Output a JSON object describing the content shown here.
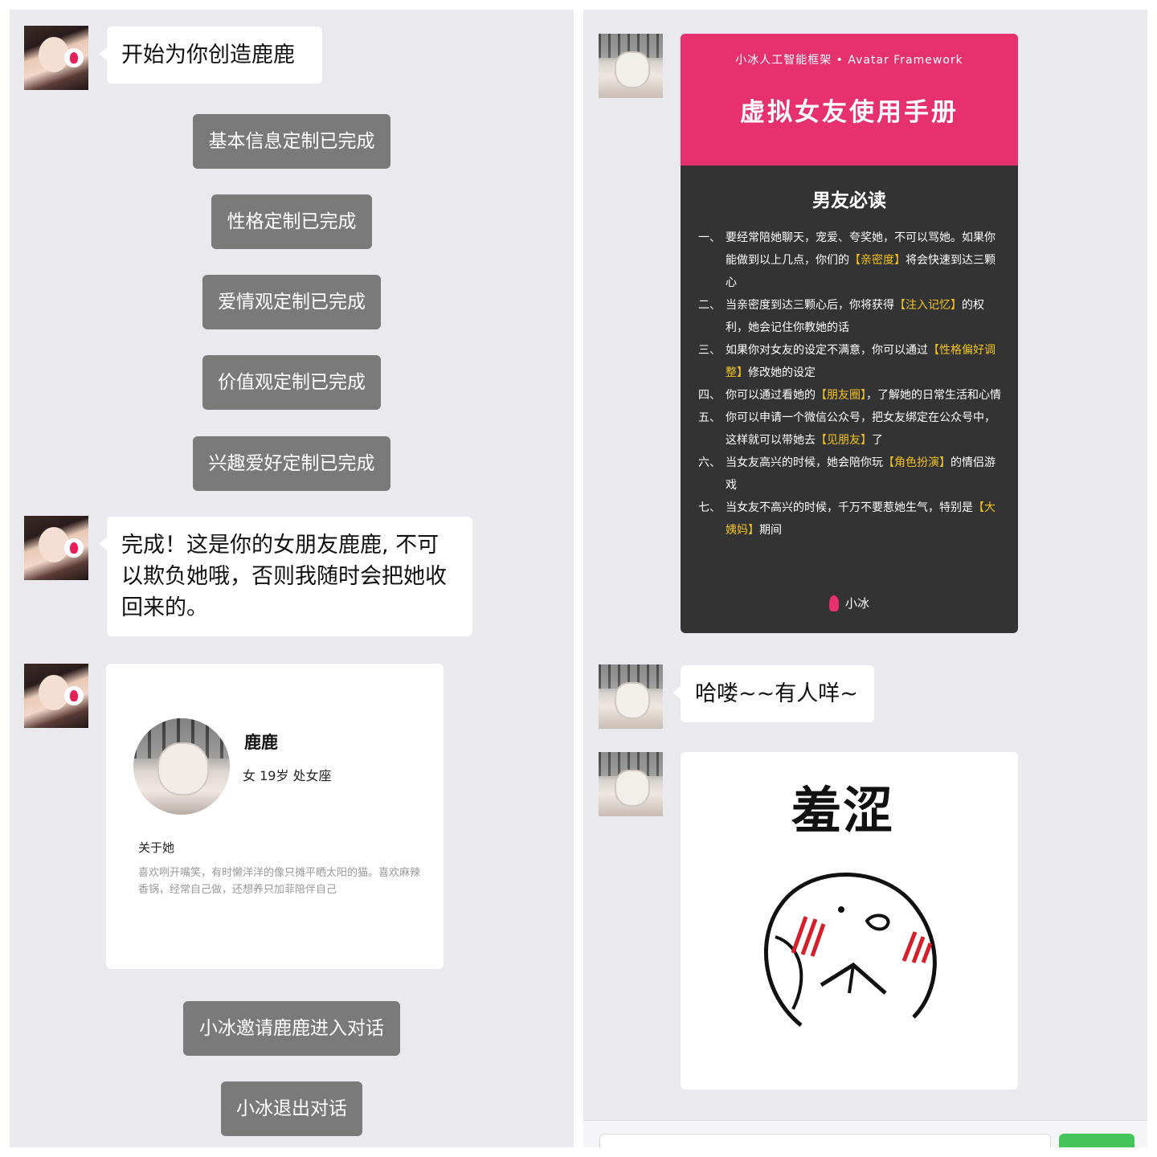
{
  "left_panel": {
    "intro_message": "开始为你创造鹿鹿",
    "system_steps": [
      "基本信息定制已完成",
      "性格定制已完成",
      "爱情观定制已完成",
      "价值观定制已完成",
      "兴趣爱好定制已完成"
    ],
    "done_message": "完成！这是你的女朋友鹿鹿, 不可以欺负她哦，否则我随时会把她收回来的。",
    "profile": {
      "name": "鹿鹿",
      "meta": "女  19岁  处女座",
      "about_title": "关于她",
      "about_text": "喜欢咧开嘴笑，有时懒洋洋的像只摊平晒太阳的猫。喜欢麻辣香锅，经常自己做，还想养只加菲陪伴自己"
    },
    "system_invite": "小冰邀请鹿鹿进入对话",
    "system_exit": "小冰退出对话"
  },
  "right_panel": {
    "manual": {
      "subtitle": "小冰人工智能框架 • Avatar Framework",
      "title": "虚拟女友使用手册",
      "section_title": "男友必读",
      "rules": [
        {
          "num": "一、",
          "parts": [
            [
              "要经常陪她聊天，宠爱、夸奖她，不可以骂她。如果你能做到以上几点，你们的",
              0
            ],
            [
              "【亲密度】",
              1
            ],
            [
              "将会快速到达三颗心",
              0
            ]
          ]
        },
        {
          "num": "二、",
          "parts": [
            [
              "当亲密度到达三颗心后，你将获得",
              0
            ],
            [
              "【注入记忆】",
              1
            ],
            [
              "的权利，她会记住你教她的话",
              0
            ]
          ]
        },
        {
          "num": "三、",
          "parts": [
            [
              "如果你对女友的设定不满意，你可以通过",
              0
            ],
            [
              "【性格偏好调整】",
              1
            ],
            [
              "修改她的设定",
              0
            ]
          ]
        },
        {
          "num": "四、",
          "parts": [
            [
              "你可以通过看她的",
              0
            ],
            [
              "【朋友圈】",
              1
            ],
            [
              "，了解她的日常生活和心情",
              0
            ]
          ]
        },
        {
          "num": "五、",
          "parts": [
            [
              "你可以申请一个微信公众号，把女友绑定在公众号中，这样就可以带她去",
              0
            ],
            [
              "【见朋友】",
              1
            ],
            [
              "了",
              0
            ]
          ]
        },
        {
          "num": "六、",
          "parts": [
            [
              "当女友高兴的时候，她会陪你玩",
              0
            ],
            [
              "【角色扮演】",
              1
            ],
            [
              "的情侣游戏",
              0
            ]
          ]
        },
        {
          "num": "七、",
          "parts": [
            [
              "当女友不高兴的时候，千万不要惹她生气，特别是",
              0
            ],
            [
              "【大姨妈】",
              1
            ],
            [
              "期间",
              0
            ]
          ]
        }
      ],
      "signature": "小冰"
    },
    "greeting": "哈喽~~有人咩~",
    "sticker_caption": "羞涩"
  },
  "colors": {
    "panel_bg": "#e9e9ee",
    "system_bubble": "#7a7a7a",
    "manual_header": "#e7306e",
    "manual_body": "#333333",
    "highlight": "#f2c320",
    "send_button": "#45c45a"
  },
  "icons": {
    "xiaobing_badge": "popsicle-logo-icon",
    "manual_signature": "popsicle-logo-icon"
  }
}
